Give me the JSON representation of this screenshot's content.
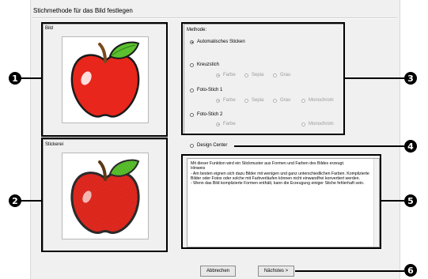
{
  "dialog": {
    "title": "Stichmethode für das Bild festlegen",
    "image_label": "Bild",
    "embroidery_label": "Stickerei",
    "method_label": "Methode:"
  },
  "method": {
    "auto": "Automatisches Sticken",
    "cross": "Kreuzstich",
    "photo1": "Foto-Stich 1",
    "photo2": "Foto-Stich 2",
    "color": "Farbe",
    "sepia": "Sepia",
    "gray": "Grau",
    "mono": "Monochrom"
  },
  "design_center": "Design Center",
  "description": "Mit dieser Funktion wird ein Stickmuster aus Formen und Farben des Bildes erzeugt.\nHinweis\n- Am besten eignen sich dazu Bilder mit wenigen und ganz unterschiedlichen Farben. Komplizierte Bilder oder Fotos oder solche mit Farbverläufen können nicht  einwandfrei konvertiert werden.\n- Wenn das Bild komplizierte Formen enthält, kann die Erzeugung einiger Stiche fehlerhaft sein.",
  "buttons": {
    "cancel": "Abbrechen",
    "next": "Nächstes >"
  },
  "callouts": [
    "1",
    "2",
    "3",
    "4",
    "5",
    "6"
  ],
  "colors": {
    "apple_red": "#e8261c",
    "leaf_green": "#5bbf2f",
    "stem_brown": "#7a4a1e"
  },
  "icons": {
    "image_preview": "apple-image",
    "embroidery_preview": "apple-embroidery"
  }
}
